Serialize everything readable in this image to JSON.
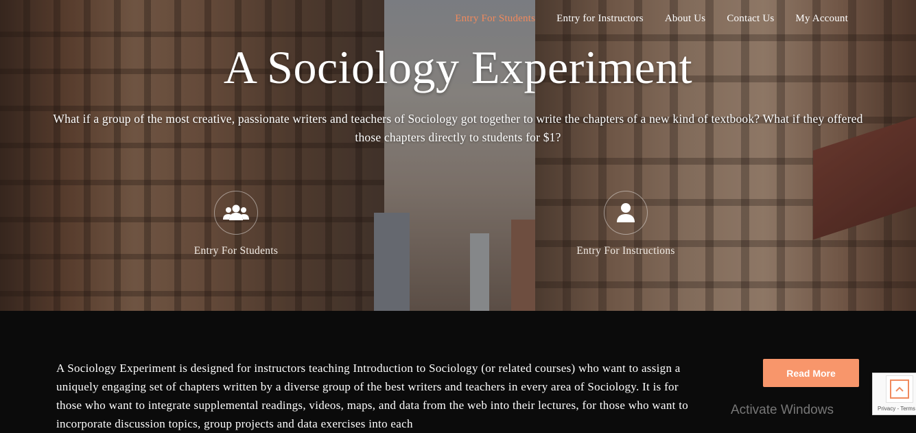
{
  "nav": {
    "items": [
      {
        "label": "Entry For Students",
        "active": true
      },
      {
        "label": "Entry for Instructors",
        "active": false
      },
      {
        "label": "About Us",
        "active": false
      },
      {
        "label": "Contact Us",
        "active": false
      },
      {
        "label": "My Account",
        "active": false
      }
    ]
  },
  "hero": {
    "title": "A Sociology Experiment",
    "subtitle": "What if a group of the most creative, passionate writers and teachers of Sociology got together to write the chapters of a new kind of textbook? What if they offered those chapters directly to students for $1?",
    "features": [
      {
        "label": "Entry For Students",
        "icon": "users-icon"
      },
      {
        "label": "Entry For Instructions",
        "icon": "user-icon"
      }
    ]
  },
  "content": {
    "description": "A Sociology Experiment is designed for instructors teaching Introduction to Sociology (or related courses) who want to assign a uniquely engaging set of chapters written by a diverse group of the best writers and teachers in every area of Sociology. It is for those who want to integrate supplemental readings, videos, maps, and data from the web into their lectures, for those who want to incorporate discussion topics, group projects and data exercises into each",
    "read_more": "Read More"
  },
  "system": {
    "activate_windows": "Activate Windows",
    "recaptcha_text": "Privacy - Terms"
  },
  "colors": {
    "accent": "#f08a5d",
    "button": "#f8966b",
    "dark_bg": "#0b0b0b"
  }
}
